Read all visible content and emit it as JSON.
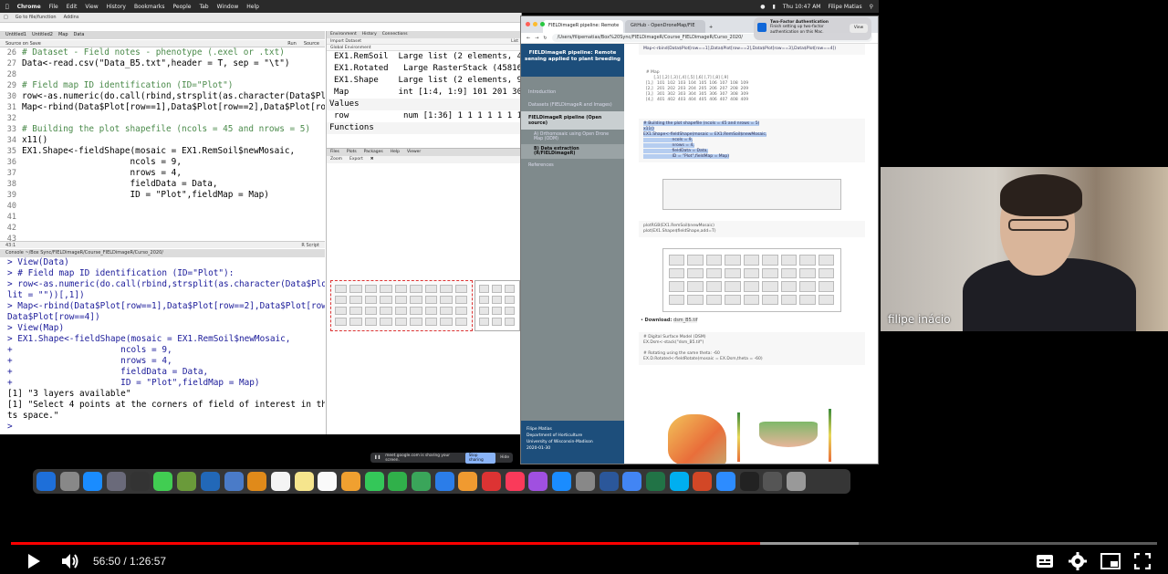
{
  "menubar": {
    "app": "Chrome",
    "items": [
      "File",
      "Edit",
      "View",
      "History",
      "Bookmarks",
      "People",
      "Tab",
      "Window",
      "Help"
    ],
    "clock": "Thu 10:47 AM",
    "user": "Filipe Matias"
  },
  "rstudio": {
    "toolbar": [
      "Go to file/function",
      "Addins"
    ],
    "editor_tabs": [
      "Untitled1",
      "Untitled2",
      "Map",
      "Data"
    ],
    "editor_bar": [
      "Source on Save",
      "Run",
      "Source"
    ],
    "code_lines": [
      {
        "n": "26",
        "t": "# Dataset - Field notes - phenotype (.exel or .txt)",
        "c": true
      },
      {
        "n": "27",
        "t": "Data<-read.csv(\"Data_B5.txt\",header = T, sep = \"\\t\")",
        "c": false
      },
      {
        "n": "28",
        "t": "",
        "c": false
      },
      {
        "n": "29",
        "t": "# Field map ID identification (ID=\"Plot\")",
        "c": true
      },
      {
        "n": "30",
        "t": "row<-as.numeric(do.call(rbind,strsplit(as.character(Data$Plot),sp",
        "c": false
      },
      {
        "n": "31",
        "t": "Map<-rbind(Data$Plot[row==1],Data$Plot[row==2],Data$Plot[row==3],",
        "c": false
      },
      {
        "n": "32",
        "t": "",
        "c": false
      },
      {
        "n": "33",
        "t": "# Building the plot shapefile (ncols = 45 and nrows = 5)",
        "c": true
      },
      {
        "n": "34",
        "t": "x11()",
        "c": false
      },
      {
        "n": "35",
        "t": "EX1.Shape<-fieldShape(mosaic = EX1.RemSoil$newMosaic,",
        "c": false
      },
      {
        "n": "36",
        "t": "                     ncols = 9,",
        "c": false
      },
      {
        "n": "37",
        "t": "                     nrows = 4,",
        "c": false
      },
      {
        "n": "38",
        "t": "                     fieldData = Data,",
        "c": false
      },
      {
        "n": "39",
        "t": "                     ID = \"Plot\",fieldMap = Map)",
        "c": false
      },
      {
        "n": "40",
        "t": "",
        "c": false
      },
      {
        "n": "41",
        "t": "",
        "c": false
      },
      {
        "n": "42",
        "t": "",
        "c": false
      },
      {
        "n": "43",
        "t": "",
        "c": false
      }
    ],
    "editor_status_left": "43:1",
    "editor_status_right": "R Script",
    "console_header": "Console   ~/Box Sync/FIELDimageR/Course_FIELDimageR/Curso_2020/",
    "console_lines": [
      {
        "t": "> View(Data)",
        "p": true
      },
      {
        "t": "> # Field map ID identification (ID=\"Plot\"):",
        "p": true
      },
      {
        "t": "> row<-as.numeric(do.call(rbind,strsplit(as.character(Data$Plot),sp",
        "p": true
      },
      {
        "t": "lit = \"\"))[,1])",
        "p": true
      },
      {
        "t": "> Map<-rbind(Data$Plot[row==1],Data$Plot[row==2],Data$Plot[row==3],",
        "p": true
      },
      {
        "t": "Data$Plot[row==4])",
        "p": true
      },
      {
        "t": "> View(Map)",
        "p": true
      },
      {
        "t": "> EX1.Shape<-fieldShape(mosaic = EX1.RemSoil$newMosaic,",
        "p": true
      },
      {
        "t": "+                     ncols = 9,",
        "p": true
      },
      {
        "t": "+                     nrows = 4,",
        "p": true
      },
      {
        "t": "+                     fieldData = Data,",
        "p": true
      },
      {
        "t": "+                     ID = \"Plot\",fieldMap = Map)",
        "p": true
      },
      {
        "t": "[1] \"3 layers available\"",
        "p": false
      },
      {
        "t": "[1] \"Select 4 points at the corners of field of interest in the plo",
        "p": false
      },
      {
        "t": "ts space.\"",
        "p": false
      },
      {
        "t": ">",
        "p": true
      }
    ],
    "env_tabs": [
      "Environment",
      "History",
      "Connections"
    ],
    "env_bar": [
      "Import Dataset",
      "List"
    ],
    "env_scope": "Global Environment",
    "env_rows": [
      {
        "k": "EX1.RemSoil",
        "v": "Large list (2 elements, 4"
      },
      {
        "k": "EX1.Rotated",
        "v": "Large RasterStack (45816"
      },
      {
        "k": "EX1.Shape",
        "v": "Large list (2 elements, 9"
      },
      {
        "k": "Map",
        "v": "int [1:4, 1:9] 101 201 30"
      }
    ],
    "env_values_label": "Values",
    "env_values_rows": [
      {
        "k": "row",
        "v": "num [1:36] 1 1 1 1 1 1 1"
      }
    ],
    "env_functions_label": "Functions",
    "files_tabs": [
      "Files",
      "Plots",
      "Packages",
      "Help",
      "Viewer"
    ],
    "files_bar": [
      "Zoom",
      "Export"
    ]
  },
  "chrome": {
    "tabs": [
      "FIELDimageR pipeline: Remote",
      "GitHub - OpenDroneMap/FIE"
    ],
    "address": "/Users/filipematias/Box%20Sync/FIELDimageR/Course_FIELDimageR/Curso_2020/",
    "doc_title": "FIELDimageR pipeline: Remote sensing applied to plant breeding",
    "sidebar_items": [
      {
        "label": "Introduction",
        "active": false
      },
      {
        "label": "Datasets (FIELDimageR and Images)",
        "active": false
      },
      {
        "label": "FIELDimageR pipeline (Open source)",
        "active": true
      }
    ],
    "sidebar_subs": [
      {
        "label": "A) Orthomosaic using Open Drone Map (ODM)",
        "sel": false
      },
      {
        "label": "B) Data extraction (R/FIELDimageR)",
        "sel": true
      }
    ],
    "sidebar_refs": "References",
    "footer": [
      "Filipe Matias",
      "Department of Horticulture",
      "University of Wisconsin-Madison",
      "2020-01-30"
    ],
    "code_top": "Map<-rbind(Data$Plot[row==1],Data$Plot[row==2],Data$Plot[row==3],Data$Plot[row==4])",
    "map_output": "  # Map\n        [,1] [,2] [,3] [,4] [,5] [,6] [,7] [,8] [,9]\n  [1,]   101  102  103  104  105  106  107  108  109\n  [2,]   201  202  203  204  205  206  207  208  209\n  [3,]   301  302  303  304  305  306  307  308  309\n  [4,]   401  402  403  404  405  406  407  408  409",
    "shape_code": "# Building the plot shapefile (ncols = 45 and nrows = 5)\nx11()\nEX1.Shape<-fieldShape(mosaic = EX1.RemSoil$newMosaic,\n                      ncols = 9,\n                      nrows = 4,\n                      fieldData = Data,\n                      ID = \"Plot\",fieldMap = Map)",
    "plot_code": "plotRGB(EX1.RemSoil$newMosaic)\nplot(EX1.Shape$fieldShape,add=T)",
    "download_label": "Download:",
    "download_file": "dsm_B5.tif",
    "dsm_code": "# Digital Surface Model (DSM)\nEX.Dsm<-stack(\"dsm_B5.tif\")\n\n# Rotating using the same theta: -60\nEX.D.Rotated<-fieldRotate(mosaic = EX.Dsm,theta = -60)"
  },
  "notification": {
    "title": "Two-Factor Authentication",
    "body": "Finish setting up two-factor authentication on this Mac.",
    "button": "View"
  },
  "meet": {
    "text": "meet.google.com is sharing your screen.",
    "stop": "Stop sharing",
    "hide": "Hide"
  },
  "dock_icons": [
    "finder-icon",
    "launchpad-icon",
    "safari-icon",
    "rocket-icon",
    "github-icon",
    "qt-icon",
    "qgis-icon",
    "r-icon",
    "preview-icon",
    "books-icon",
    "calendar-icon",
    "notes-icon",
    "reminders-icon",
    "photos-icon",
    "messages-icon",
    "facetime-icon",
    "numbers-icon",
    "keynote-icon",
    "pages-icon",
    "no-entry-icon",
    "music-icon",
    "podcasts-icon",
    "appstore-icon",
    "settings-icon",
    "word-icon",
    "chrome-icon",
    "excel-icon",
    "skype-icon",
    "powerpoint-icon",
    "zoom-icon",
    "terminal-icon",
    "screenshot-icon",
    "trash-icon"
  ],
  "webcam": {
    "name": "filipe inácio"
  },
  "player": {
    "time_current": "56:50",
    "time_total": "1:26:57",
    "time_display": "56:50 / 1:26:57",
    "played_fraction": 0.654,
    "buffered_fraction": 0.74,
    "colors": {
      "played": "#ff0000",
      "buffer": "#9a9a9a",
      "track": "#5a5a5a"
    }
  }
}
